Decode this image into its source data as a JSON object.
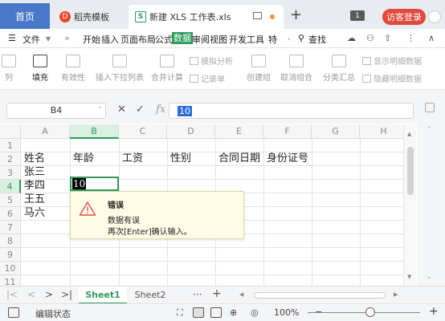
{
  "titlebar": {
    "tabs": [
      {
        "label": "首页"
      },
      {
        "label": "稻壳模板"
      },
      {
        "label": "新建 XLS 工作表.xls"
      }
    ],
    "new_tab": "+",
    "badge": "1",
    "login": "访客登录"
  },
  "menubar": {
    "file": "文件",
    "items": [
      "开始",
      "插入",
      "页面布局",
      "公式",
      "数据",
      "审阅",
      "视图",
      "开发工具",
      "特"
    ],
    "active": "数据",
    "search": "查找"
  },
  "ribbon": {
    "buttons": [
      "列",
      "填充",
      "有效性",
      "插入下拉列表",
      "合并计算",
      "创建组",
      "取消组合",
      "分类汇总"
    ],
    "small": [
      "模拟分析",
      "记录单",
      "显示明细数据",
      "隐藏明细数据"
    ]
  },
  "formula": {
    "namebox": "B4",
    "fx": "fx",
    "value": "10"
  },
  "columns": [
    "A",
    "B",
    "C",
    "D",
    "E",
    "F",
    "G",
    "H"
  ],
  "rows": [
    "1",
    "2",
    "3",
    "4",
    "5",
    "6",
    "7",
    "8",
    "9",
    "10",
    "11"
  ],
  "cells": {
    "A2": "姓名",
    "B2": "年龄",
    "C2": "工资",
    "D2": "性别",
    "E2": "合同日期",
    "F2": "身份证号",
    "A3": "张三",
    "A4": "李四",
    "A5": "王五",
    "A6": "马六",
    "B4": "10"
  },
  "error_popup": {
    "title": "错误",
    "line1": "数据有误",
    "line2": "再次[Enter]确认输入。"
  },
  "sheets": {
    "active": "Sheet1",
    "other": "Sheet2",
    "more": "···",
    "add": "+"
  },
  "status": {
    "text": "编辑状态",
    "zoom": "100%",
    "minus": "−",
    "plus": "+"
  }
}
